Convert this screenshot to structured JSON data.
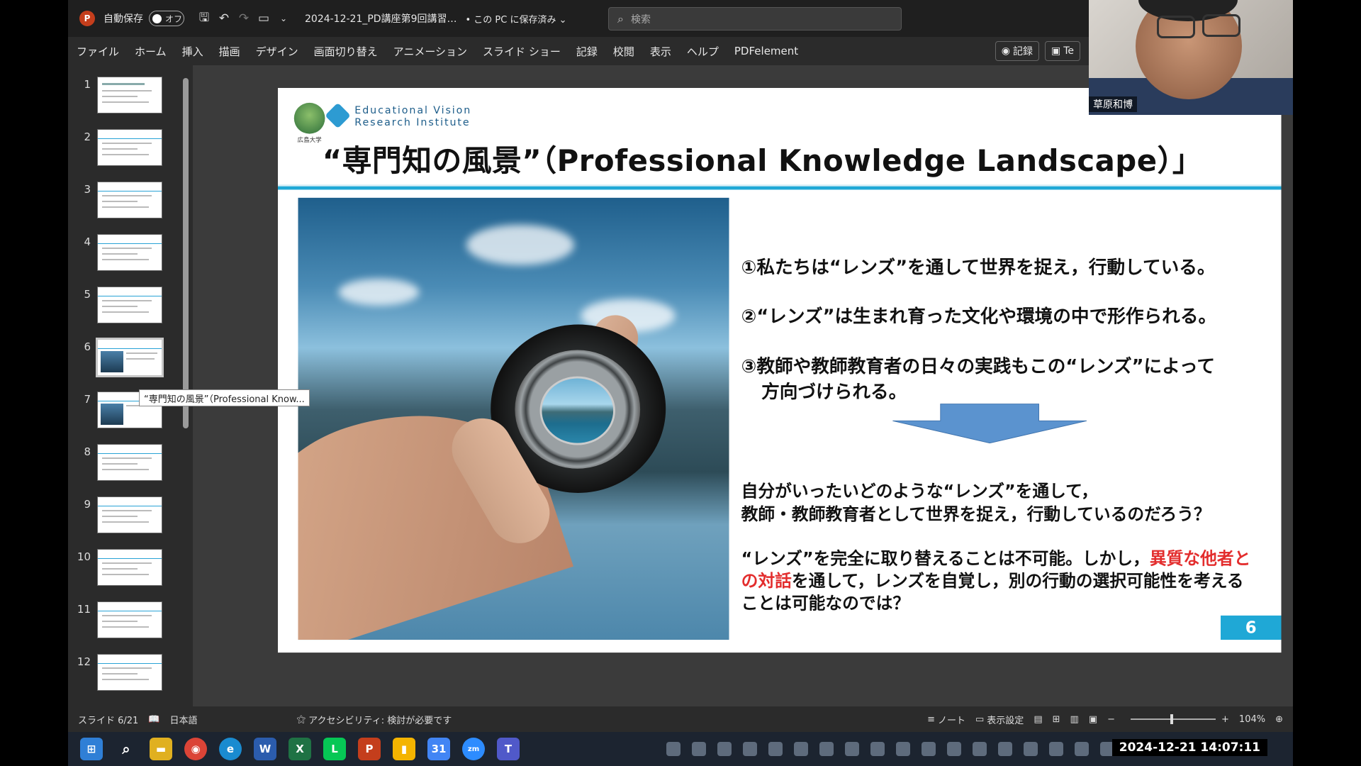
{
  "titlebar": {
    "autosave_label": "自動保存",
    "autosave_state": "オフ",
    "doc_title": "2024-12-21_PD講座第9回講習…",
    "save_status": "• この PC に保存済み ⌄",
    "search_placeholder": "検索"
  },
  "ribbon": {
    "tabs": [
      "ファイル",
      "ホーム",
      "挿入",
      "描画",
      "デザイン",
      "画面切り替え",
      "アニメーション",
      "スライド ショー",
      "記録",
      "校閲",
      "表示",
      "ヘルプ",
      "PDFelement"
    ],
    "record_button": "記録",
    "teams_button": "Te"
  },
  "slide_panel": {
    "numbers": [
      "1",
      "2",
      "3",
      "4",
      "5",
      "6",
      "7",
      "8",
      "9",
      "10",
      "11",
      "12"
    ],
    "active_index": 6,
    "tooltip": "“専門知の風景”（Professional Know..."
  },
  "slide": {
    "logo_caption": "広島大学",
    "institute_line1": "Educational Vision",
    "institute_line2": "Research Institute",
    "title": "“専門知の風景”（Professional Knowledge Landscape）」",
    "point1": "①私たちは“レンズ”を通して世界を捉え，行動している。",
    "point2": "②“レンズ”は生まれ育った文化や環境の中で形作られる。",
    "point3_a": "③教師や教師教育者の日々の実践もこの“レンズ”によって",
    "point3_b": "方向づけられる。",
    "question_a": "自分がいったいどのような“レンズ”を通して，",
    "question_b": "教師・教師教育者として世界を捉え，行動しているのだろう？",
    "concl_a1": "“レンズ”を完全に取り替えることは不可能。しかし，",
    "concl_a2_red": "異質な他者と",
    "concl_b1_red": "の対話",
    "concl_b2": "を通して，レンズを自覚し，別の行動の選択可能性を考える",
    "concl_c": "ことは可能なのでは？",
    "page_number": "6",
    "accent_color": "#1fa8d6",
    "highlight_color": "#e32d2d"
  },
  "webcam": {
    "name": "草原和博"
  },
  "status": {
    "slide_counter": "スライド 6/21",
    "language": "日本語",
    "accessibility": "アクセシビリティ: 検討が必要です",
    "notes": "ノート",
    "display_settings": "表示設定",
    "zoom": "104%"
  },
  "taskbar": {
    "clock": "2024-12-21  14:07:11"
  }
}
